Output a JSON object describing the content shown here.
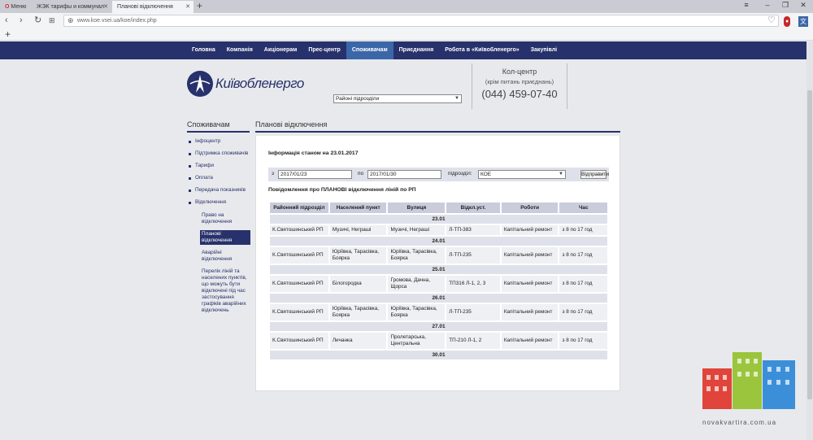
{
  "browser": {
    "tabs": [
      {
        "label": "Меню",
        "active": false
      },
      {
        "label": "ЖЭК тарифы и коммунал",
        "active": false
      },
      {
        "label": "Планові відключення",
        "active": true
      }
    ],
    "url": "www.koe.vsei.ua/koe/index.php",
    "new_tab": "+",
    "bookmark_add": "+"
  },
  "site": {
    "nav": [
      "Головна",
      "Компанія",
      "Акціонерам",
      "Прес-центр",
      "Споживачам",
      "Приєднання",
      "Робота в «Київобленерго»",
      "Закупівлі"
    ],
    "nav_active": "Споживачам",
    "logo_text": "Київобленерго",
    "region_select": "Районі підрозділи",
    "callcenter": {
      "title": "Кол-центр",
      "subtitle": "(крім питань приєднань)",
      "phone": "(044) 459-07-40"
    }
  },
  "sidebar": {
    "title": "Споживачам",
    "items": [
      "Інфоцентр",
      "Підтримка споживачів",
      "Тарифи",
      "Оплата",
      "Передача показників",
      "Відключення"
    ],
    "subitems": [
      "Право на відключення",
      "Планові відключення",
      "Аварійні відключення",
      "Перелік ліній та населених пунктів, що можуть бути відключені під час застосування графіків аварійних відключень"
    ],
    "active_sub": "Планові відключення"
  },
  "main": {
    "title": "Планові відключення",
    "info_date": "Інформація станом на 23.01.2017",
    "filter": {
      "from_label": "з",
      "from_value": "2017/01/23",
      "to_label": "по",
      "to_value": "2017/01/30",
      "unit_label": "підрозділ:",
      "unit_value": "КОЕ",
      "apply": "Відправити"
    },
    "notice": "Повідомлення про ПЛАНОВІ відключення ліній по РП",
    "headers": [
      "Районний підрозділ",
      "Населений пункт",
      "Вулиця",
      "Відкл.уст.",
      "Роботи",
      "Час"
    ],
    "rows": [
      {
        "date": "23.01"
      },
      {
        "cells": [
          "К.Святошинський РП",
          "Музичі, Неграші",
          "Музичі, Неграші",
          "Л-ТП-383",
          "Капітальний ремонт",
          "з 8 по 17 год"
        ]
      },
      {
        "date": "24.01"
      },
      {
        "cells": [
          "К.Святошинський РП",
          "Юріївка, Тарасівка, Боярка",
          "Юріївка, Тарасівка, Боярка",
          "Л-ТП-235",
          "Капітальний ремонт",
          "з 8 по 17 год"
        ]
      },
      {
        "date": "25.01"
      },
      {
        "cells": [
          "К.Святошинський РП",
          "Білогородка",
          "Громова, Дачна, Щорса",
          "ТП316 Л-1, 2, 3",
          "Капітальний ремонт",
          "з 8 по 17 год"
        ]
      },
      {
        "date": "26.01"
      },
      {
        "cells": [
          "К.Святошинський РП",
          "Юріївка, Тарасівка, Боярка",
          "Юріївка, Тарасівка, Боярка",
          "Л-ТП-235",
          "Капітальний ремонт",
          "з 8 по 17 год"
        ]
      },
      {
        "date": "27.01"
      },
      {
        "cells": [
          "К.Святошинський РП",
          "Личанка",
          "Пролетарська, Центральна",
          "ТП-210 Л-1, 2",
          "Капітальний ремонт",
          "з 8 по 17 год"
        ]
      },
      {
        "date": "30.01"
      }
    ]
  },
  "watermark": "novakvartira.com.ua"
}
